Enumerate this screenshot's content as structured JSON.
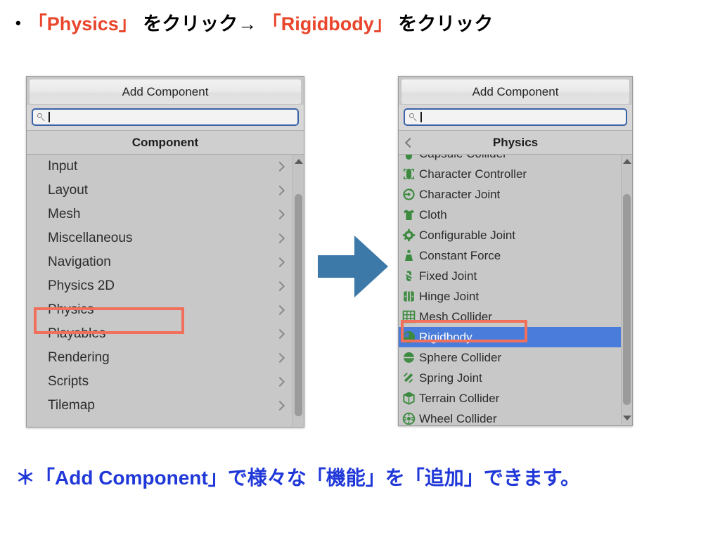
{
  "slide": {
    "heading": {
      "bullet": "•",
      "segments": [
        {
          "text": "「Physics」",
          "color": "#E8452B"
        },
        {
          "text": " をクリック→ ",
          "color": "#000000"
        },
        {
          "text": "「Rigidbody」",
          "color": "#E8452B"
        },
        {
          "text": " をクリック",
          "color": "#000000"
        }
      ],
      "plain": "• 「Physics」 をクリック→ 「Rigidbody」 をクリック"
    },
    "footer_note": "＊「Add Component」で様々な「機能」を「追加」できます。",
    "accent_red": "#E8452B",
    "annotation_box_color": "#F0705B",
    "footer_color": "#2038D8",
    "arrow_color": "#3D79A8"
  },
  "left_panel": {
    "title": "Add Component",
    "search": {
      "value": "",
      "placeholder": "",
      "icon": "search-icon"
    },
    "section_header": "Component",
    "items": [
      {
        "label": "Input",
        "chevron": "chevron-right-icon"
      },
      {
        "label": "Layout",
        "chevron": "chevron-right-icon"
      },
      {
        "label": "Mesh",
        "chevron": "chevron-right-icon"
      },
      {
        "label": "Miscellaneous",
        "chevron": "chevron-right-icon"
      },
      {
        "label": "Navigation",
        "chevron": "chevron-right-icon"
      },
      {
        "label": "Physics 2D",
        "chevron": "chevron-right-icon"
      },
      {
        "label": "Physics",
        "chevron": "chevron-right-icon",
        "highlighted": true
      },
      {
        "label": "Playables",
        "chevron": "chevron-right-icon"
      },
      {
        "label": "Rendering",
        "chevron": "chevron-right-icon"
      },
      {
        "label": "Scripts",
        "chevron": "chevron-right-icon"
      },
      {
        "label": "Tilemap",
        "chevron": "chevron-right-icon"
      }
    ],
    "scrollbar": {
      "has_up_arrow": true,
      "has_down_arrow": false
    }
  },
  "right_panel": {
    "title": "Add Component",
    "search": {
      "value": "",
      "placeholder": "",
      "icon": "search-icon"
    },
    "section_header": "Physics",
    "back_icon": "chevron-left-icon",
    "items": [
      {
        "label": "Capsule Collider",
        "icon": "capsule-collider-icon",
        "clipped": true
      },
      {
        "label": "Character Controller",
        "icon": "character-controller-icon"
      },
      {
        "label": "Character Joint",
        "icon": "character-joint-icon"
      },
      {
        "label": "Cloth",
        "icon": "cloth-icon"
      },
      {
        "label": "Configurable Joint",
        "icon": "configurable-joint-icon"
      },
      {
        "label": "Constant Force",
        "icon": "constant-force-icon"
      },
      {
        "label": "Fixed Joint",
        "icon": "fixed-joint-icon"
      },
      {
        "label": "Hinge Joint",
        "icon": "hinge-joint-icon"
      },
      {
        "label": "Mesh Collider",
        "icon": "mesh-collider-icon"
      },
      {
        "label": "Rigidbody",
        "icon": "rigidbody-icon",
        "selected": true,
        "highlighted": true
      },
      {
        "label": "Sphere Collider",
        "icon": "sphere-collider-icon"
      },
      {
        "label": "Spring Joint",
        "icon": "spring-joint-icon"
      },
      {
        "label": "Terrain Collider",
        "icon": "terrain-collider-icon"
      },
      {
        "label": "Wheel Collider",
        "icon": "wheel-collider-icon"
      }
    ],
    "selection_color": "#4A7DDB",
    "icon_color": "#3C8A3F",
    "scrollbar": {
      "has_up_arrow": true,
      "has_down_arrow": true
    }
  }
}
